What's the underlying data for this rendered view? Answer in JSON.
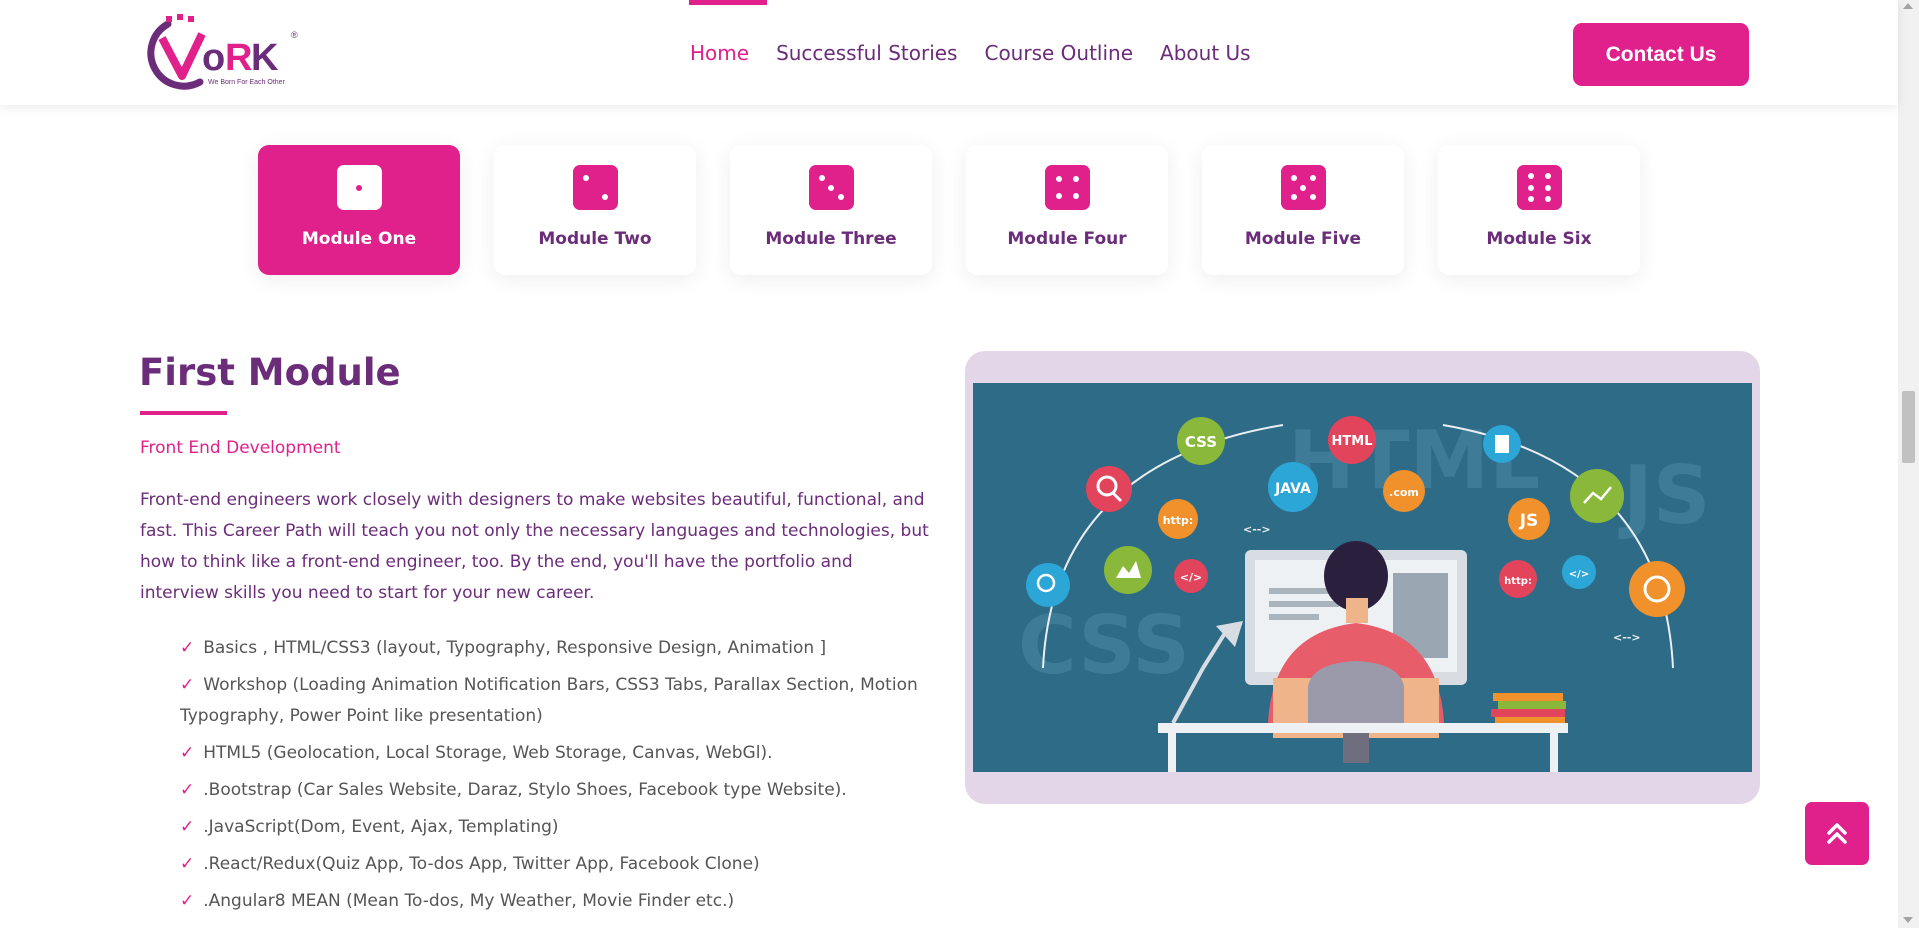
{
  "brand": {
    "logo_text": "VoRK",
    "tagline": "We Born For Each Other",
    "colors": {
      "primary": "#e0208b",
      "secondary": "#6b2c7a"
    }
  },
  "nav": {
    "items": [
      {
        "label": "Home",
        "active": true
      },
      {
        "label": "Successful Stories",
        "active": false
      },
      {
        "label": "Course Outline",
        "active": false
      },
      {
        "label": "About Us",
        "active": false
      }
    ],
    "contact_label": "Contact Us"
  },
  "modules": [
    {
      "label": "Module One",
      "icon": "dice-one-icon",
      "active": true
    },
    {
      "label": "Module Two",
      "icon": "dice-two-icon",
      "active": false
    },
    {
      "label": "Module Three",
      "icon": "dice-three-icon",
      "active": false
    },
    {
      "label": "Module Four",
      "icon": "dice-four-icon",
      "active": false
    },
    {
      "label": "Module Five",
      "icon": "dice-five-icon",
      "active": false
    },
    {
      "label": "Module Six",
      "icon": "dice-six-icon",
      "active": false
    }
  ],
  "content": {
    "title": "First Module",
    "subtitle": "Front End Development",
    "description": "Front-end engineers work closely with designers to make websites beautiful, functional, and fast. This Career Path will teach you not only the necessary languages and technologies, but how to think like a front-end engineer, too. By the end, you'll have the portfolio and interview skills you need to start for your new career.",
    "topics": [
      "Basics , HTML/CSS3 (layout, Typography, Responsive Design, Animation ]",
      "Workshop (Loading Animation Notification Bars, CSS3 Tabs, Parallax Section, Motion Typography, Power Point like presentation)",
      "HTML5 (Geolocation, Local Storage, Web Storage, Canvas, WebGl).",
      ".Bootstrap (Car Sales Website, Daraz, Stylo Shoes, Facebook type Website).",
      ".JavaScript(Dom, Event, Ajax, Templating)",
      ".React/Redux(Quiz App, To-dos App, Twitter App, Facebook Clone)",
      ".Angular8 MEAN (Mean To-dos, My Weather, Movie Finder etc.)"
    ]
  },
  "illustration": {
    "labels": {
      "css": "CSS",
      "html": "HTML",
      "java": "JAVA",
      "com": ".com",
      "js": "JS",
      "http": "http:",
      "tag": "</>",
      "arrows": "<-->",
      "bg_html": "HTML",
      "bg_css": "CSS",
      "bg_js": "JS"
    }
  },
  "back_to_top": {
    "icon": "double-chevron-up-icon"
  }
}
